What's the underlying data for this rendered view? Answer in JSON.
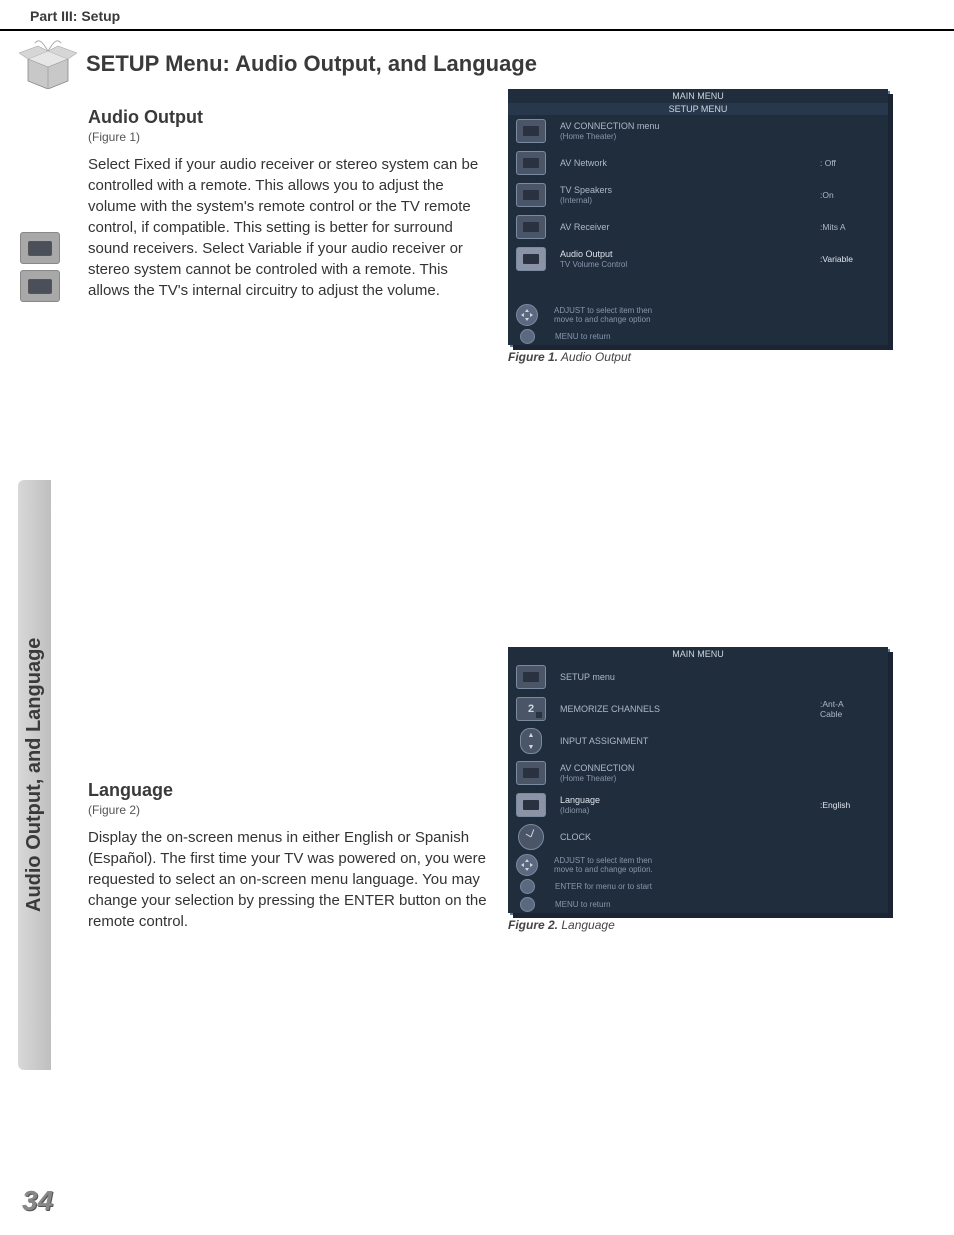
{
  "header": {
    "part": "Part III: Setup"
  },
  "title": "SETUP Menu: Audio Output, and Language",
  "sidebar_tab": "Audio Output, and Language",
  "page_number": "34",
  "section1": {
    "heading": "Audio Output",
    "figref": "(Figure 1)",
    "body": "Select Fixed if your audio receiver or stereo system can be controlled with a remote. This allows you to adjust the volume with the system's remote control or the TV remote control, if compatible. This setting is better for surround sound receivers. Select Variable if your audio receiver or stereo system cannot be controled with a remote. This allows the TV's internal circuitry to adjust the volume.",
    "caption_bold": "Figure 1.",
    "caption_ital": "  Audio Output"
  },
  "section2": {
    "heading": "Language",
    "figref": "(Figure 2)",
    "body": "Display the on-screen menus in either English or Spanish (Español). The first time your TV was powered on, you were requested to select an on-screen menu language. You may change your selection by pressing the ENTER button on the remote control.",
    "caption_bold": "Figure 2.",
    "caption_ital": "  Language"
  },
  "fig1": {
    "header": "MAIN MENU",
    "subheader": "SETUP MENU",
    "rows": [
      {
        "label": "AV CONNECTION menu",
        "sub": "(Home Theater)",
        "value": ""
      },
      {
        "label": "AV Network",
        "value": ": Off"
      },
      {
        "label": "TV Speakers",
        "sub": "(Internal)",
        "value": ":On"
      },
      {
        "label": "AV Receiver",
        "value": ":Mits A"
      },
      {
        "label": "Audio Output",
        "sub": "TV Volume Control",
        "value": ":Variable",
        "active": true
      }
    ],
    "hint1": "ADJUST to select item then",
    "hint1b": "move to and change option",
    "hint2": "MENU to return"
  },
  "fig2": {
    "header": "MAIN MENU",
    "rows": [
      {
        "label": "SETUP menu",
        "value": ""
      },
      {
        "label": "MEMORIZE CHANNELS",
        "value": ":Ant-A",
        "value2": " Cable"
      },
      {
        "label": "INPUT ASSIGNMENT",
        "value": ""
      },
      {
        "label": "AV CONNECTION",
        "sub": "(Home Theater)",
        "value": ""
      },
      {
        "label": "Language",
        "sub": "(Idioma)",
        "value": ":English",
        "active": true
      },
      {
        "label": "CLOCK",
        "value": ""
      }
    ],
    "hint1": "ADJUST to select item then",
    "hint1b": "move to and change option.",
    "hint2": "ENTER for menu or to start",
    "hint3": "MENU to return"
  }
}
